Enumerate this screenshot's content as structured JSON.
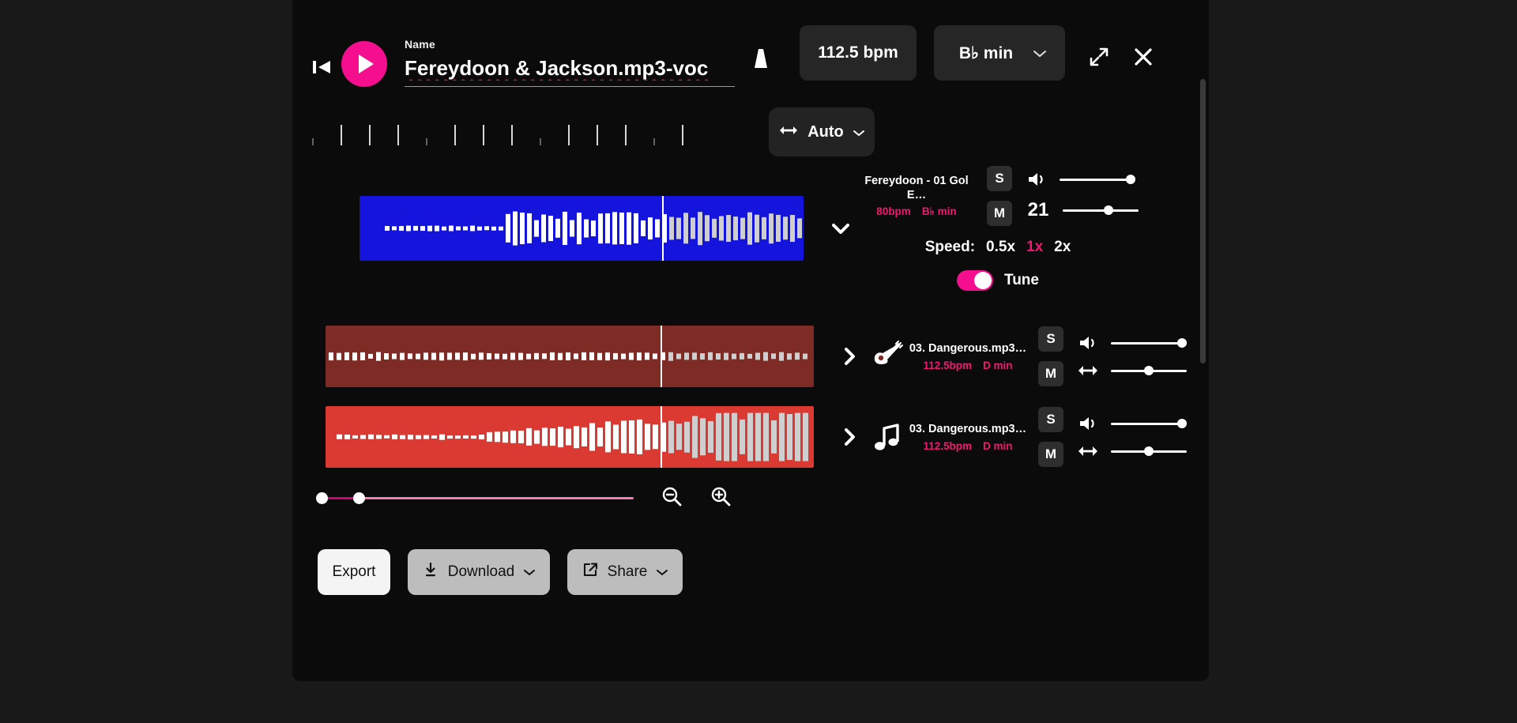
{
  "header": {
    "prev_icon": "skip-previous-icon",
    "play_icon": "play-icon",
    "name_label": "Name",
    "name_value": "Fereydoon & Jackson.mp3-voc",
    "bell_icon": "metronome-icon",
    "bpm": "112.5 bpm",
    "key": "B♭ min",
    "key_chevron": "chevron-down-icon",
    "expand_icon": "expand-icon",
    "close_icon": "close-icon"
  },
  "toolbar": {
    "auto_label": "Auto",
    "auto_icon": "arrows-horizontal-icon",
    "auto_chevron": "chevron-down-icon"
  },
  "tracks": [
    {
      "expander": "chevron-down-icon",
      "icon": "",
      "title": "Fereydoon - 01 Gol E…",
      "bpm": "80bpm",
      "key": "B♭ min",
      "solo": "S",
      "mute": "M",
      "volume_icon": "volume-icon",
      "volume_pct": 100,
      "second_icon": "",
      "pitch_value": "21",
      "pitch_pct": 62,
      "color": "#1414dd",
      "expanded": true
    },
    {
      "expander": "chevron-right-icon",
      "icon": "guitar-icon",
      "title": "03. Dangerous.mp3…",
      "bpm": "112.5bpm",
      "key": "D min",
      "solo": "S",
      "mute": "M",
      "volume_icon": "volume-icon",
      "volume_pct": 100,
      "second_icon": "arrows-horizontal-icon",
      "pitch_value": "",
      "pitch_pct": 50,
      "color": "#7e2b26",
      "expanded": false
    },
    {
      "expander": "chevron-right-icon",
      "icon": "music-note-icon",
      "title": "03. Dangerous.mp3…",
      "bpm": "112.5bpm",
      "key": "D min",
      "solo": "S",
      "mute": "M",
      "volume_icon": "volume-icon",
      "volume_pct": 100,
      "second_icon": "arrows-horizontal-icon",
      "pitch_value": "",
      "pitch_pct": 50,
      "color": "#da3a32",
      "expanded": false
    }
  ],
  "speed": {
    "label": "Speed:",
    "options": [
      "0.5x",
      "1x",
      "2x"
    ],
    "active": "1x"
  },
  "tune": {
    "label": "Tune",
    "enabled": true
  },
  "zoom": {
    "start_pct": 0,
    "end_pct": 13,
    "zoom_out_icon": "zoom-out-icon",
    "zoom_in_icon": "zoom-in-icon"
  },
  "footer": {
    "export_label": "Export",
    "download_label": "Download",
    "download_icon": "download-icon",
    "download_chevron": "chevron-down-icon",
    "share_label": "Share",
    "share_icon": "external-link-icon",
    "share_chevron": "chevron-down-icon"
  },
  "colors": {
    "accent": "#f50f8f",
    "accent_text": "#f2186f",
    "panel": "#0b0b0b",
    "pill": "#262626"
  }
}
